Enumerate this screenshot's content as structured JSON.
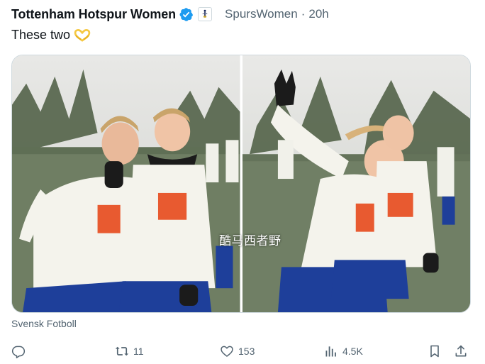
{
  "author": {
    "name": "Tottenham Hotspur Women",
    "handle": "SpursWomen",
    "separator": "·",
    "time": "20h"
  },
  "tweet": {
    "text": "These two"
  },
  "media": {
    "watermark": "酷马西者野",
    "source": "Svensk Fotboll"
  },
  "actions": {
    "replies": "",
    "retweets": "11",
    "likes": "153",
    "views": "4.5K"
  },
  "colors": {
    "verified": "#1d9bf0",
    "muted": "#536471",
    "text": "#0f1419",
    "heart_hands": "#f5c842"
  },
  "icons": [
    "verified-badge-icon",
    "spurs-affiliate-icon",
    "heart-hands-emoji-icon",
    "reply-icon",
    "retweet-icon",
    "like-icon",
    "views-icon",
    "bookmark-icon",
    "share-icon"
  ]
}
